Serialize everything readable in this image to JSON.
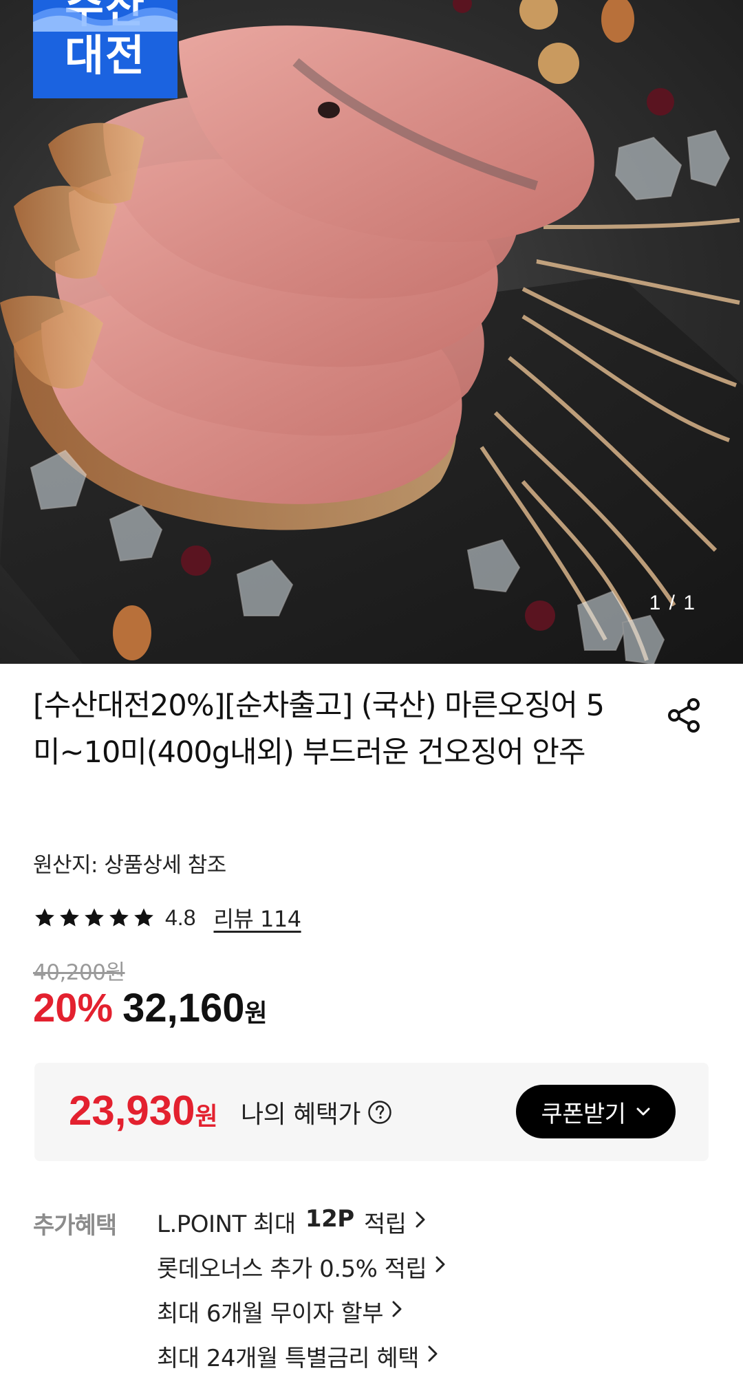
{
  "hero": {
    "badge_text": "수산\n대전",
    "counter": "1 / 1",
    "image_subject": "dried squid on slate with almonds, walnuts, cranberries and ice"
  },
  "product": {
    "title": "[수산대전20%][순차출고] (국산) 마른오징어 5미~10미(400g내외) 부드러운 건오징어 안주",
    "origin": "원산지: 상품상세 참조",
    "rating": "4.8",
    "rating_stars": 5,
    "review_link": "리뷰 114",
    "original_price": "40,200원",
    "discount": "20%",
    "sale_price": "32,160",
    "sale_unit": "원"
  },
  "benefit": {
    "amount": "23,930",
    "unit": "원",
    "label": "나의 혜택가",
    "coupon_button": "쿠폰받기"
  },
  "extra": {
    "label": "추가혜택",
    "items": [
      {
        "prefix": "L.POINT 최대 ",
        "bold": "12P",
        "suffix": " 적립"
      },
      {
        "prefix": "롯데오너스 추가 0.5% 적립",
        "bold": "",
        "suffix": ""
      },
      {
        "prefix": "최대 6개월 무이자 할부",
        "bold": "",
        "suffix": ""
      },
      {
        "prefix": "최대 24개월 특별금리 혜택",
        "bold": "",
        "suffix": ""
      }
    ]
  },
  "colors": {
    "accent_red": "#e3212f",
    "badge_blue": "#1b63e0",
    "button_black": "#000000"
  },
  "icons": {
    "share": "share-icon",
    "star": "star-icon",
    "help": "question-circle-icon",
    "chevron_down": "chevron-down-icon",
    "chevron_right": "chevron-right-icon"
  }
}
